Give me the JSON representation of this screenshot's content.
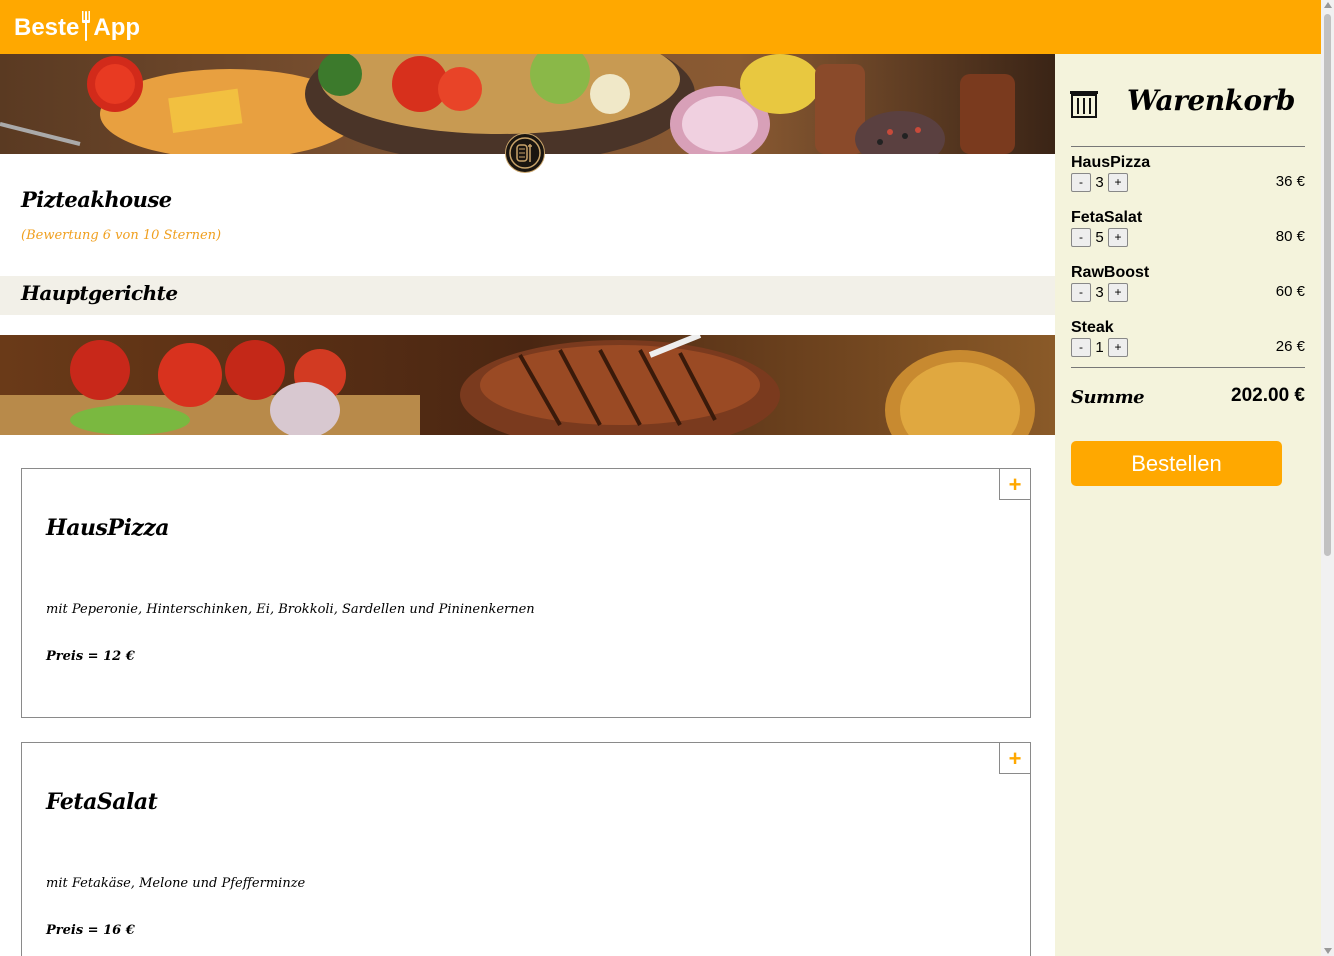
{
  "app": {
    "logo_left": "Beste",
    "logo_right": "App"
  },
  "restaurant": {
    "name": "Pizteakhouse",
    "rating": "(Bewertung 6 von 10 Sternen)"
  },
  "section": {
    "title": "Hauptgerichte"
  },
  "dishes": [
    {
      "name": "HausPizza",
      "description": "mit Peperonie, Hinterschinken, Ei, Brokkoli, Sardellen und Pininenkernen",
      "price": "Preis = 12 €",
      "add_label": "+"
    },
    {
      "name": "FetaSalat",
      "description": "mit Fetakäse, Melone und Pfefferminze",
      "price": "Preis = 16 €",
      "add_label": "+"
    }
  ],
  "cart": {
    "title": "Warenkorb",
    "items": [
      {
        "name": "HausPizza",
        "qty": "3",
        "price": "36 €",
        "minus": "-",
        "plus": "+"
      },
      {
        "name": "FetaSalat",
        "qty": "5",
        "price": "80 €",
        "minus": "-",
        "plus": "+"
      },
      {
        "name": "RawBoost",
        "qty": "3",
        "price": "60 €",
        "minus": "-",
        "plus": "+"
      },
      {
        "name": "Steak",
        "qty": "1",
        "price": "26 €",
        "minus": "-",
        "plus": "+"
      }
    ],
    "sum_label": "Summe",
    "sum_value": "202.00 €",
    "order_label": "Bestellen"
  },
  "colors": {
    "accent": "#ffa800",
    "cart_bg": "#f4f3dc",
    "section_bg": "#f2f0e8",
    "rating": "#f0a020"
  }
}
